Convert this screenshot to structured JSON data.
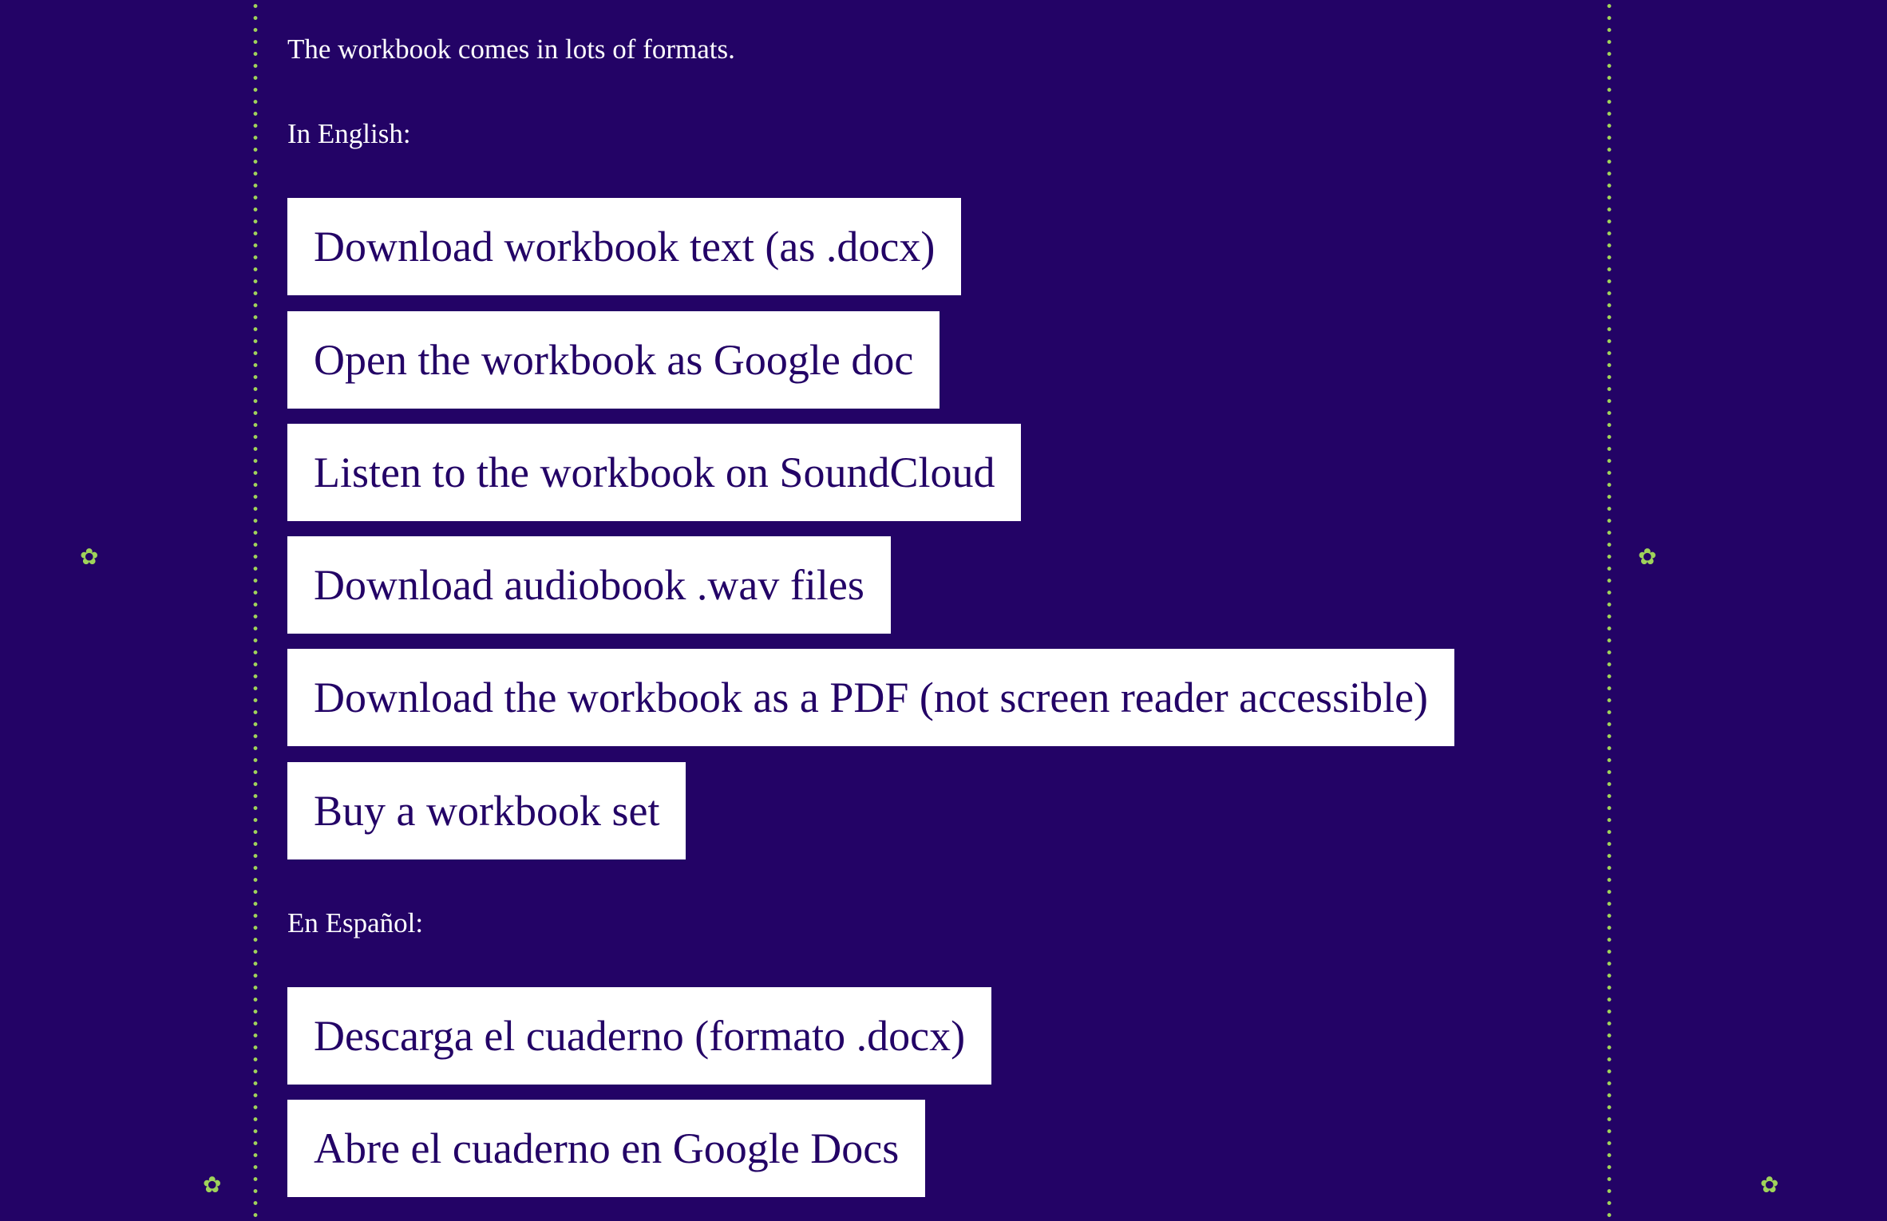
{
  "intro_text": "The workbook comes in lots of formats.",
  "english": {
    "label": "In English:",
    "buttons": [
      "Download workbook text (as .docx)",
      "Open the workbook as Google doc",
      "Listen to the workbook on SoundCloud",
      "Download audiobook .wav files",
      "Download the workbook as a PDF (not screen reader accessible)",
      "Buy a workbook set"
    ]
  },
  "spanish": {
    "label": "En Español:",
    "buttons": [
      "Descarga el cuaderno (formato .docx)",
      "Abre el cuaderno en Google Docs"
    ]
  },
  "decorations": {
    "flower_glyph": "✿",
    "accent_color": "#9fd35a",
    "background_color": "#230366",
    "button_color": "#ffffff",
    "button_text_color": "#230366"
  }
}
